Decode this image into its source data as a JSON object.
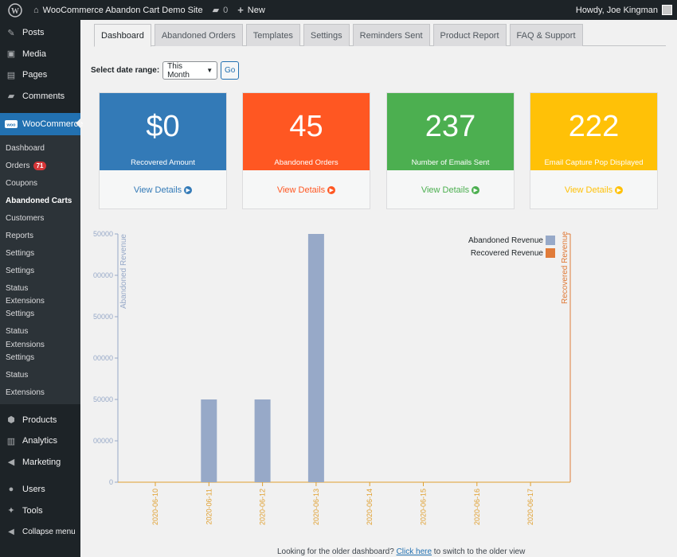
{
  "adminbar": {
    "site_name": "WooCommerce Abandon Cart Demo Site",
    "comments_count": "0",
    "new_label": "New",
    "howdy": "Howdy, Joe Kingman"
  },
  "sidebar": {
    "top_items": [
      {
        "label": "Posts",
        "icon": "pin-icon"
      },
      {
        "label": "Media",
        "icon": "media-icon"
      },
      {
        "label": "Pages",
        "icon": "pages-icon"
      },
      {
        "label": "Comments",
        "icon": "comments-icon"
      }
    ],
    "woocommerce_label": "WooCommerce",
    "submenu": [
      "Dashboard",
      "Orders",
      "Coupons",
      "Abandoned Carts",
      "Customers",
      "Reports",
      "Settings",
      "Settings",
      "Status",
      "Extensions",
      "Settings",
      "Status",
      "Extensions",
      "Settings",
      "Status",
      "Extensions"
    ],
    "orders_badge": "71",
    "bottom_items": [
      {
        "label": "Products",
        "icon": "products-icon"
      },
      {
        "label": "Analytics",
        "icon": "analytics-icon"
      },
      {
        "label": "Marketing",
        "icon": "marketing-icon"
      },
      {
        "label": "Users",
        "icon": "users-icon"
      },
      {
        "label": "Tools",
        "icon": "tools-icon"
      },
      {
        "label": "Collapse menu",
        "icon": "collapse-icon"
      }
    ]
  },
  "tabs": [
    "Dashboard",
    "Abandoned Orders",
    "Templates",
    "Settings",
    "Reminders Sent",
    "Product Report",
    "FAQ & Support"
  ],
  "daterange": {
    "label": "Select date range:",
    "selected": "This Month",
    "go": "Go"
  },
  "cards": [
    {
      "value": "$0",
      "caption": "Recovered Amount",
      "link": "View Details",
      "color": "#337ab7"
    },
    {
      "value": "45",
      "caption": "Abandoned Orders",
      "link": "View Details",
      "color": "#ff5722"
    },
    {
      "value": "237",
      "caption": "Number of Emails Sent",
      "link": "View Details",
      "color": "#4caf50"
    },
    {
      "value": "222",
      "caption": "Email Capture Pop Displayed",
      "link": "View Details",
      "color": "#ffc107"
    }
  ],
  "chart_data": {
    "type": "bar",
    "categories": [
      "2020-06-10",
      "2020-06-11",
      "2020-06-12",
      "2020-06-13",
      "2020-06-14",
      "2020-06-15",
      "2020-06-16",
      "2020-06-17"
    ],
    "series": [
      {
        "name": "Abandoned Revenue",
        "values": [
          0,
          100000,
          100000,
          300000,
          0,
          0,
          0,
          0
        ],
        "color": "#97a9c8"
      },
      {
        "name": "Recovered Revenue",
        "values": [
          0,
          0,
          0,
          0,
          0,
          0,
          0,
          0
        ],
        "color": "#e07b39"
      }
    ],
    "yticks": [
      "0",
      "00000",
      "50000",
      "00000",
      "50000",
      "00000",
      "50000"
    ],
    "ylim": [
      0,
      300000
    ],
    "ylabel_left": "Abandoned Revenue",
    "ylabel_right": "Recovered Revenue",
    "legend": "top-right"
  },
  "footer": {
    "before": "Looking for the older dashboard? ",
    "link": "Click here",
    "after": " to switch to the older view"
  }
}
